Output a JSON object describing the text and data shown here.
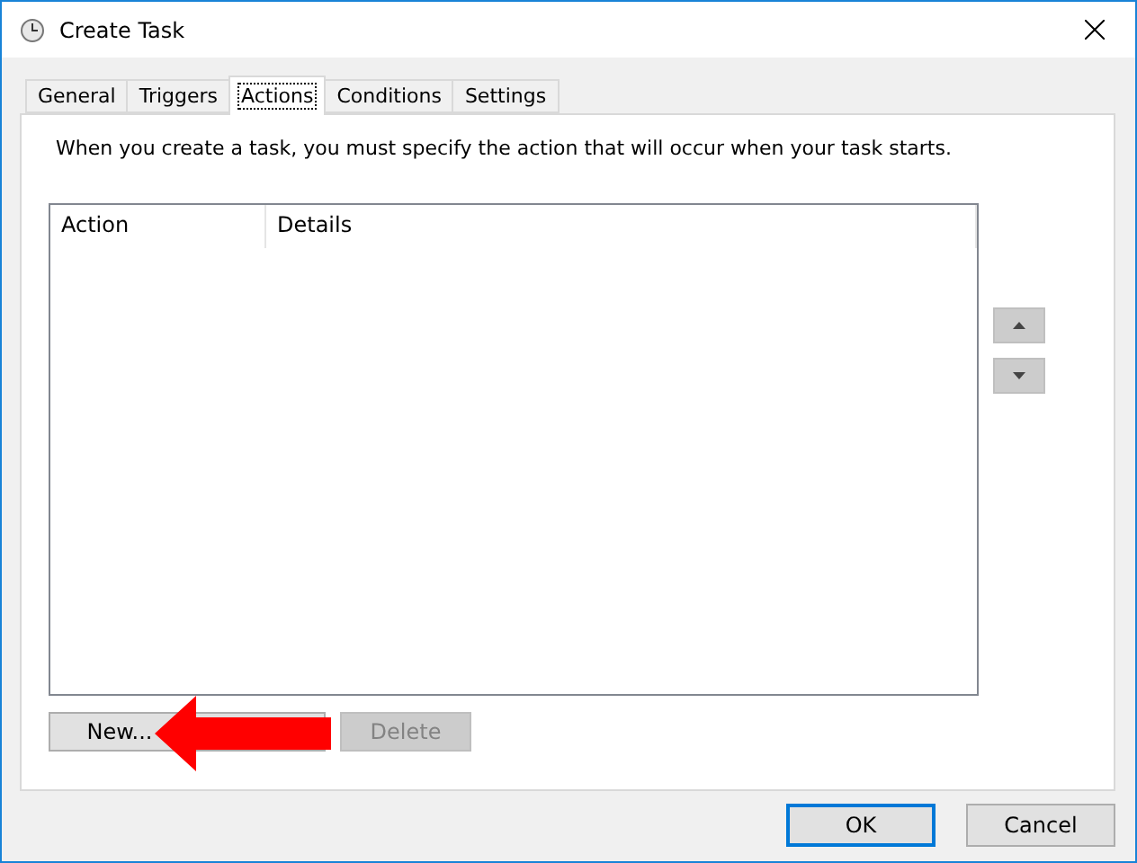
{
  "window": {
    "title": "Create Task"
  },
  "tabs": [
    {
      "label": "General",
      "selected": false
    },
    {
      "label": "Triggers",
      "selected": false
    },
    {
      "label": "Actions",
      "selected": true
    },
    {
      "label": "Conditions",
      "selected": false
    },
    {
      "label": "Settings",
      "selected": false
    }
  ],
  "description": "When you create a task, you must specify the action that will occur when your task starts.",
  "table": {
    "columns": [
      "Action",
      "Details"
    ]
  },
  "action_buttons": [
    {
      "label": "New...",
      "disabled": false
    },
    {
      "disabled": false
    },
    {
      "label": "Delete",
      "disabled": true
    }
  ],
  "dialog_buttons": [
    {
      "label": "OK",
      "default": true
    },
    {
      "label": "Cancel",
      "default": false
    }
  ]
}
